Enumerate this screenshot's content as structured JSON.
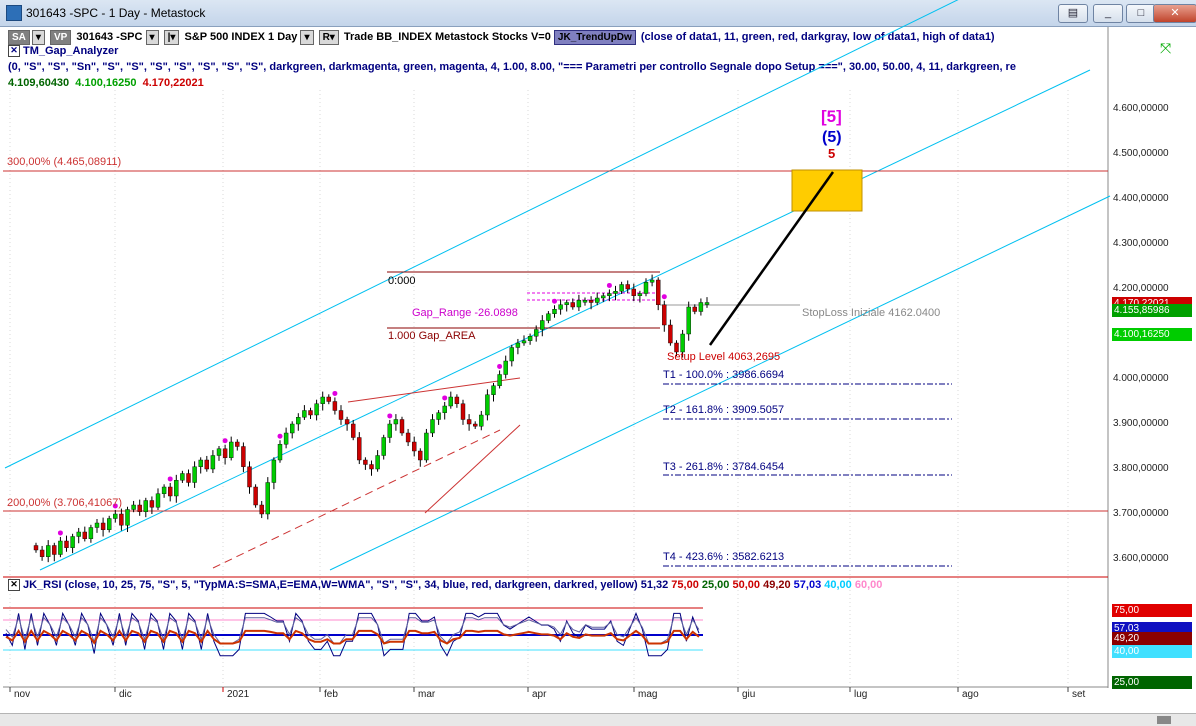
{
  "window": {
    "title": "301643 -SPC - 1 Day - Metastock",
    "min_glyph": "_",
    "max_glyph": "□",
    "close_glyph": "✕",
    "extra_glyph": "▤"
  },
  "toolbar": {
    "sa": "SA",
    "vp": "VP",
    "symbol": "301643 -SPC",
    "period_glyph": "▾",
    "name": "S&P 500 INDEX 1 Day",
    "r_btn": "R▾",
    "trade": "Trade  BB_INDEX  Metastock  Stocks  V=0",
    "indicator_btn": "JK_TrendUpDw",
    "indicator_params": "(close of data1, 11, green, red, darkgray, low of data1, high of data1)"
  },
  "analyzer": {
    "name": "TM_Gap_Analyzer",
    "params": "(0, \"S\", \"S\", \"Sn\", \"S\", \"S\", \"S\", \"S\", \"S\", \"S\", \"S\", darkgreen, darkmagenta, green, magenta, 4, 1.00, 8.00, \"=== Parametri per controllo Segnale dopo Setup ===\", 30.00, 50.00, 4, 11, darkgreen, re",
    "values": [
      "4.109,60430",
      "4.100,16250",
      "4.170,22021"
    ]
  },
  "annotations": {
    "level300": "300,00% (4.465,08911)",
    "level200": "200,00% (3.706,41067)",
    "gap_zero": "0:000",
    "gap_range": "Gap_Range -26.0898",
    "gap_area": "1.000 Gap_AREA",
    "stoploss": "StopLoss Iniziale 4162.0400",
    "setup_level": "Setup Level 4063,2695",
    "t1": "T1 - 100.0% : 3986.6694",
    "t2": "T2 - 161.8% : 3909.5057",
    "t3": "T3 - 261.8% : 3784.6454",
    "t4": "T4 - 423.6% : 3582.6213",
    "wave_bracket": "[5]",
    "wave_paren": "(5)",
    "wave_plain": "5"
  },
  "price_axis": [
    "4.600,00000",
    "4.500,00000",
    "4.400,00000",
    "4.300,00000",
    "4.200,00000",
    "4.100,00000",
    "4.000,00000",
    "3.900,00000",
    "3.800,00000",
    "3.700,00000",
    "3.600,00000"
  ],
  "price_badges": [
    {
      "text": "4.170,22021",
      "color": "#cc0000"
    },
    {
      "text": "4.155,85986",
      "color": "#00a000"
    },
    {
      "text": "4.100,16250",
      "color": "#00cc00"
    }
  ],
  "rsi": {
    "name": "JK_RSI",
    "params": "(close, 10, 25, 75, \"S\", 5, \"TypMA:S=SMA,E=EMA,W=WMA\", \"S\", \"S\", 34, blue, red, darkgreen, darkred, yellow)",
    "values": [
      {
        "text": "51,32",
        "color": "#000080"
      },
      {
        "text": "75,00",
        "color": "#cc0000"
      },
      {
        "text": "25,00",
        "color": "#006400"
      },
      {
        "text": "50,00",
        "color": "#cc0000"
      },
      {
        "text": "49,20",
        "color": "#8b0000"
      },
      {
        "text": "57,03",
        "color": "#0000cc"
      },
      {
        "text": "40,00",
        "color": "#00ccff"
      },
      {
        "text": "60,00",
        "color": "#ff88cc"
      }
    ],
    "axis_badges": [
      {
        "text": "75,00",
        "color": "#e00000"
      },
      {
        "text": "57,03",
        "color": "#1010c0"
      },
      {
        "text": "49,20",
        "color": "#8b0000"
      },
      {
        "text": "40,00",
        "color": "#40e0ff"
      },
      {
        "text": "25,00",
        "color": "#006400"
      }
    ]
  },
  "date_axis": [
    "nov",
    "dic",
    "2021",
    "feb",
    "mar",
    "apr",
    "mag",
    "giu",
    "lug",
    "ago",
    "set"
  ],
  "colors": {
    "up": "#00cc00",
    "down": "#cc0000",
    "channel": "#00c0f0",
    "target_box": "#ffcc00",
    "magenta": "#e000e0"
  },
  "candles": [
    3620,
    3605,
    3630,
    3610,
    3640,
    3625,
    3650,
    3660,
    3645,
    3670,
    3680,
    3665,
    3690,
    3700,
    3675,
    3710,
    3720,
    3705,
    3730,
    3715,
    3745,
    3760,
    3740,
    3775,
    3790,
    3770,
    3805,
    3820,
    3800,
    3830,
    3845,
    3825,
    3860,
    3850,
    3805,
    3760,
    3720,
    3700,
    3770,
    3820,
    3855,
    3880,
    3900,
    3915,
    3930,
    3920,
    3945,
    3960,
    3950,
    3930,
    3910,
    3900,
    3870,
    3820,
    3810,
    3800,
    3830,
    3870,
    3900,
    3910,
    3880,
    3860,
    3840,
    3820,
    3880,
    3910,
    3925,
    3940,
    3960,
    3945,
    3910,
    3900,
    3895,
    3920,
    3965,
    3985,
    4010,
    4040,
    4070,
    4080,
    4085,
    4095,
    4110,
    4130,
    4145,
    4155,
    4165,
    4170,
    4160,
    4175,
    4175,
    4170,
    4180,
    4185,
    4190,
    4195,
    4210,
    4200,
    4185,
    4190,
    4215,
    4220,
    4165,
    4120,
    4080,
    4060,
    4100,
    4160,
    4150,
    4170,
    4170
  ]
}
